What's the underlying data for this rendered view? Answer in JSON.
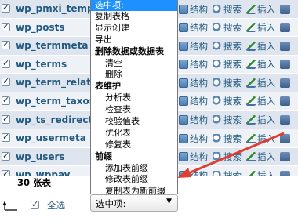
{
  "tables": [
    {
      "name": "wp_pmxi_templates",
      "shown": "wp_pmxi_templat"
    },
    {
      "name": "wp_posts",
      "shown": "wp_posts"
    },
    {
      "name": "wp_termmeta",
      "shown": "wp_termmeta"
    },
    {
      "name": "wp_terms",
      "shown": "wp_terms"
    },
    {
      "name": "wp_term_relationships",
      "shown": "wp_term_relation"
    },
    {
      "name": "wp_term_taxonomy",
      "shown": "wp_term_taxono"
    },
    {
      "name": "wp_ts_redirects",
      "shown": "wp_ts_redirects"
    },
    {
      "name": "wp_usermeta",
      "shown": "wp_usermeta"
    },
    {
      "name": "wp_users",
      "shown": "wp_users"
    },
    {
      "name": "wp_wppay",
      "shown": "wp_wppay"
    }
  ],
  "actions": {
    "structure": "结构",
    "search": "搜索",
    "insert": "插入"
  },
  "total_label": "30 张表",
  "check_all_label": "全选",
  "select": {
    "current": "选中项:",
    "options_header": "选中项:",
    "items": [
      {
        "label": "复制表格",
        "kind": "item"
      },
      {
        "label": "显示创建",
        "kind": "item"
      },
      {
        "label": "导出",
        "kind": "item"
      },
      {
        "label": "删除数据或数据表",
        "kind": "group"
      },
      {
        "label": "清空",
        "kind": "sub"
      },
      {
        "label": "删除",
        "kind": "sub"
      },
      {
        "label": "表维护",
        "kind": "group"
      },
      {
        "label": "分析表",
        "kind": "sub"
      },
      {
        "label": "检查表",
        "kind": "sub"
      },
      {
        "label": "校验值表",
        "kind": "sub"
      },
      {
        "label": "优化表",
        "kind": "sub"
      },
      {
        "label": "修复表",
        "kind": "sub"
      },
      {
        "label": "前缀",
        "kind": "group"
      },
      {
        "label": "添加表前缀",
        "kind": "sub"
      },
      {
        "label": "修改表前缀",
        "kind": "sub"
      },
      {
        "label": "复制表为新前缀",
        "kind": "sub"
      }
    ]
  },
  "colors": {
    "row_even": "#dfe5ee",
    "row_odd": "#eef1f6",
    "link": "#235a81",
    "highlight": "#1e90ff",
    "annotation_arrow": "#e03c31"
  }
}
